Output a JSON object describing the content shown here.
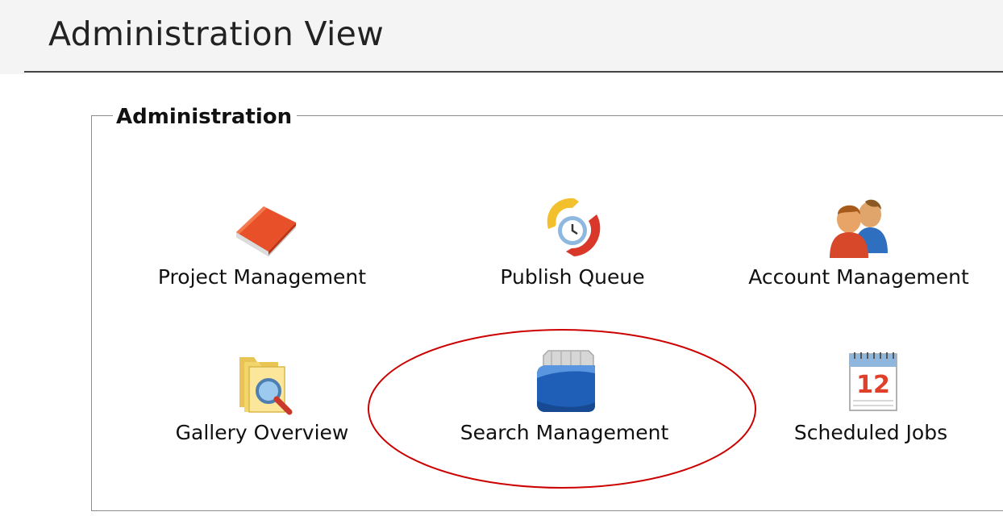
{
  "page": {
    "title": "Administration View"
  },
  "admin_panel": {
    "legend": "Administration",
    "items": [
      {
        "label": "Project Management",
        "icon": "book-icon"
      },
      {
        "label": "Publish Queue",
        "icon": "publish-queue-icon"
      },
      {
        "label": "Account Management",
        "icon": "users-icon"
      },
      {
        "label": "Gallery Overview",
        "icon": "folder-search-icon"
      },
      {
        "label": "Search Management",
        "icon": "database-icon"
      },
      {
        "label": "Scheduled Jobs",
        "icon": "calendar-icon"
      }
    ]
  },
  "calendar_icon_day": "12",
  "colors": {
    "highlight": "#cc0000",
    "fieldset_border": "#8c8c8c"
  }
}
